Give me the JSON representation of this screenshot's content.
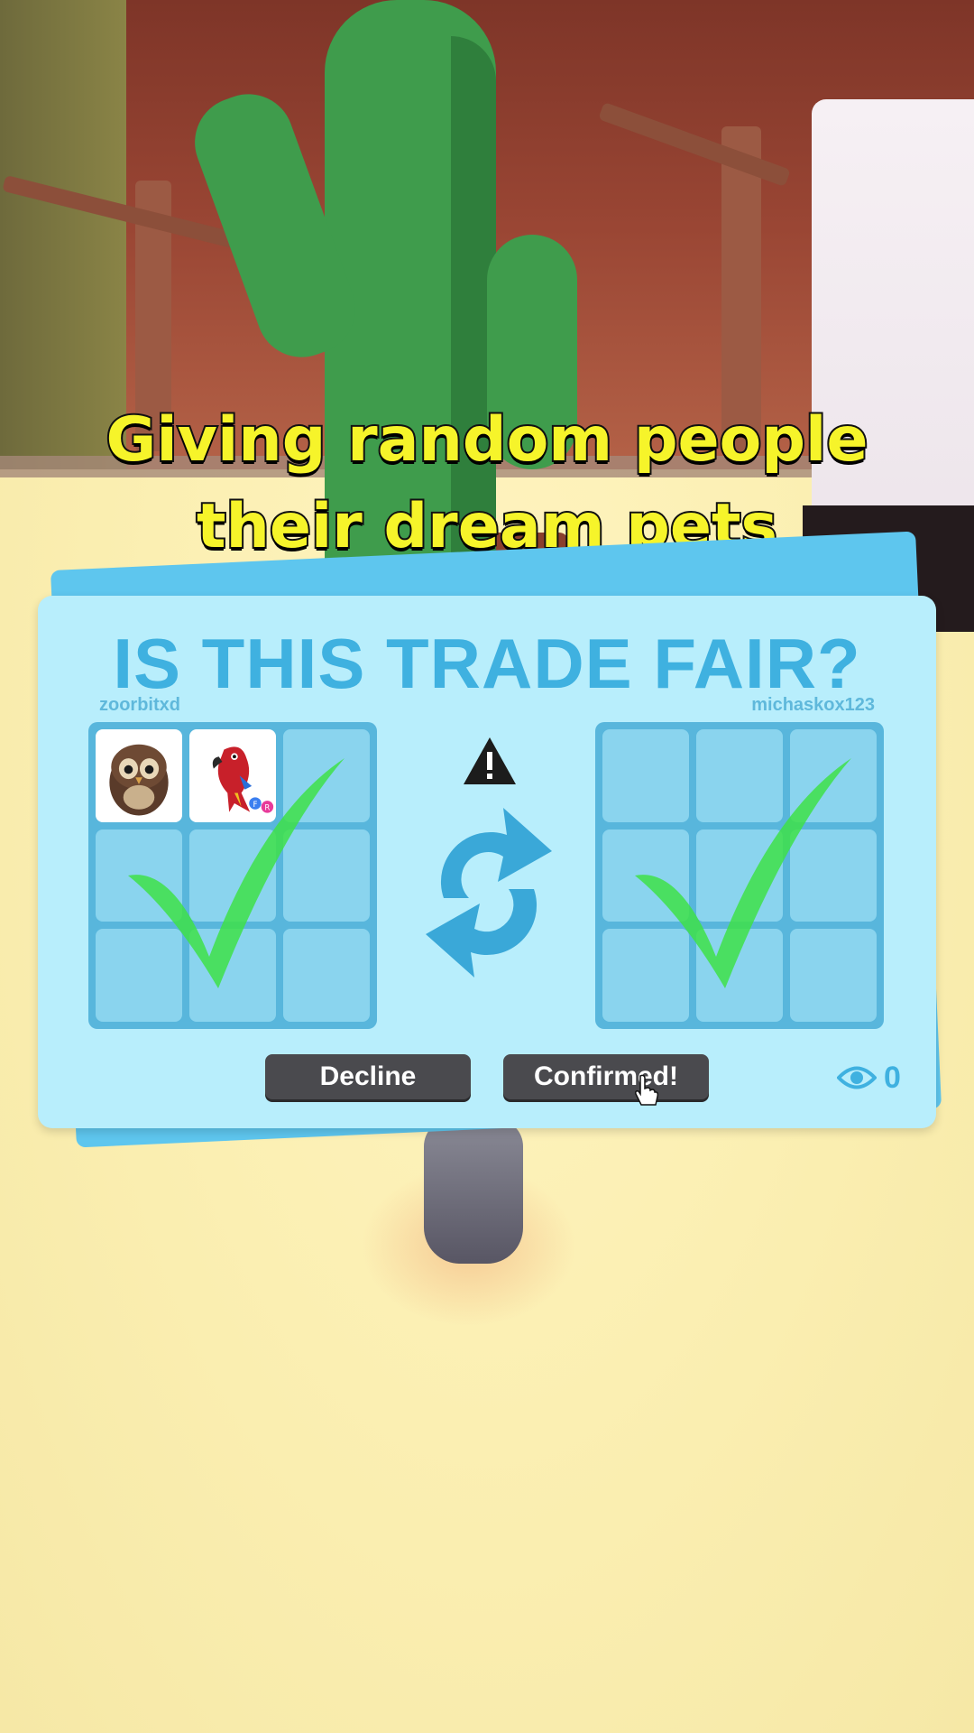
{
  "overlay": {
    "headline_line1": "Giving random people",
    "headline_line2": "their dream pets"
  },
  "trade": {
    "title": "IS THIS TRADE FAIR?",
    "left_user": "zoorbitxd",
    "right_user": "michaskox123",
    "left_items": [
      "owl-pet",
      "parrot-pet"
    ],
    "right_items": [],
    "left_confirmed": true,
    "right_confirmed": true,
    "decline_label": "Decline",
    "confirm_label": "Confirmed!",
    "viewer_count": "0",
    "parrot_badges": [
      "F",
      "R"
    ]
  },
  "colors": {
    "headline": "#f6f42a",
    "panel": "#b8eefc",
    "accent": "#3fb1e0",
    "check": "#3ee048"
  }
}
